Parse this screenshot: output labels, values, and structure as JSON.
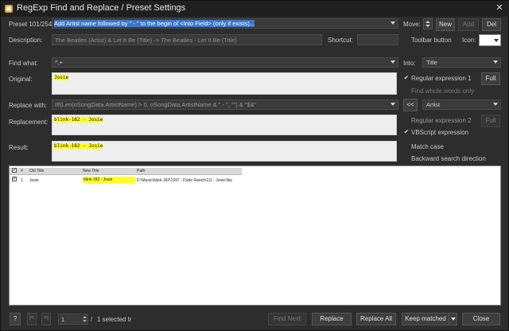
{
  "window": {
    "title": "RegExp Find and Replace / Preset Settings",
    "close_glyph": "✕"
  },
  "preset": {
    "label": "Preset 101/254:",
    "value": "Add Artist name followed by \" - \" to the begin of <Into Field> (only if exists)...",
    "move_label": "Move:",
    "new_label": "New",
    "add_label": "Add",
    "del_label": "Del"
  },
  "description": {
    "label": "Description:",
    "value": "The Beatles (Artist) & Let It Be (Title) -> The Beatles - Let It Be (Title)",
    "shortcut_label": "Shortcut:",
    "shortcut_value": "",
    "toolbar_button_label": "Toolbar button",
    "icon_label": "Icon:"
  },
  "find": {
    "label": "Find what:",
    "value": "^.+",
    "into_label": "Into:",
    "into_value": "Title"
  },
  "original": {
    "label": "Original:",
    "value": "Josie",
    "regex1_label": "Regular expression 1",
    "full_label": "Full",
    "whole_words_label": "Find whole words only"
  },
  "replace_with": {
    "label": "Replace with:",
    "value": "IIf(Len(oSongData.ArtistName) > 0, oSongData.ArtistName & \" - \", \"\") & \"$&\"",
    "insert_label": "<<",
    "field_value": "Artist"
  },
  "replacement": {
    "label": "Replacement:",
    "value": "blink-182 - Josie",
    "regex2_label": "Regular expression 2",
    "full_label": "Full",
    "vbscript_label": "VBScript expression"
  },
  "result": {
    "label": "Result:",
    "value": "blink-182 - Josie",
    "match_case_label": "Match case",
    "backward_label": "Backward search direction"
  },
  "grid": {
    "columns": [
      "#",
      "Old Title",
      "New Title",
      "Path"
    ],
    "rows": [
      {
        "num": "1",
        "old": "Josie",
        "new": "blink-182 - Josie",
        "path": "D:\\Music\\blink-182\\1997 - Dude Ranch\\111 - Josie.flac"
      }
    ]
  },
  "bottom": {
    "help_label": "?",
    "prev_label": "|<",
    "next_label": ">|",
    "page_value": "1",
    "slash": "/",
    "selected_label": "1 selected tr",
    "find_next_label": "Find Next",
    "replace_label": "Replace",
    "replace_all_label": "Replace All",
    "keep_matched_label": "Keep matched",
    "close_label": "Close"
  }
}
